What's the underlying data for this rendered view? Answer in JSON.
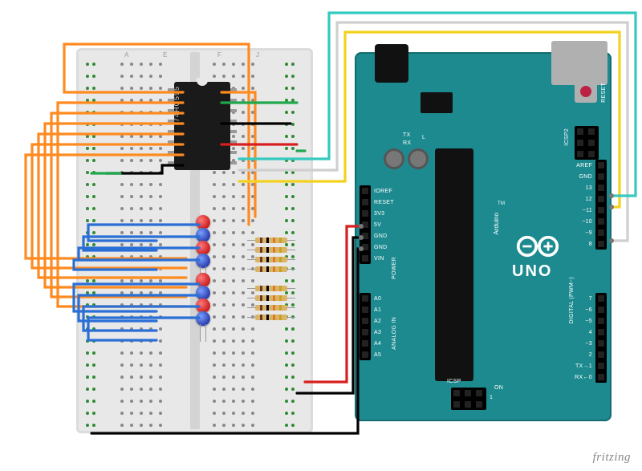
{
  "software_watermark": "fritzing",
  "ic": {
    "label": "74HC595",
    "pins": 16
  },
  "leds": [
    {
      "id": 1,
      "color": "red"
    },
    {
      "id": 2,
      "color": "blue"
    },
    {
      "id": 3,
      "color": "red"
    },
    {
      "id": 4,
      "color": "blue"
    },
    {
      "id": 5,
      "color": "red"
    },
    {
      "id": 6,
      "color": "blue"
    },
    {
      "id": 7,
      "color": "red"
    },
    {
      "id": 8,
      "color": "blue"
    }
  ],
  "resistors": {
    "count": 8,
    "bands": [
      "brown",
      "black",
      "orange",
      "gold"
    ]
  },
  "arduino": {
    "model": "UNO",
    "brand": "Arduino",
    "trademark": "TM",
    "reset_label": "RESET",
    "tx_label": "TX",
    "rx_label": "RX",
    "l_label": "L",
    "on_label": "ON",
    "icsp_label": "ICSP",
    "icsp2_label": "ICSP2",
    "power_group": "POWER",
    "analog_group": "ANALOG IN",
    "digital_group": "DIGITAL (PWM~)",
    "headers": {
      "power": [
        "IOREF",
        "RESET",
        "3V3",
        "5V",
        "GND",
        "GND",
        "VIN"
      ],
      "analog": [
        "A0",
        "A1",
        "A2",
        "A3",
        "A4",
        "A5"
      ],
      "digital_high": [
        "AREF",
        "GND",
        "13",
        "12",
        "~11",
        "~10",
        "~9",
        "8"
      ],
      "digital_low": [
        "7",
        "~6",
        "~5",
        "4",
        "~3",
        "2",
        "TX→1",
        "RX←0"
      ]
    }
  },
  "connections": {
    "shift_register_control": [
      {
        "wire": "yellow",
        "from": "74HC595 pin 14 (DS / DATA)",
        "to": "Arduino D11"
      },
      {
        "wire": "white",
        "from": "74HC595 pin 12 (ST_CP / LATCH)",
        "to": "Arduino D8"
      },
      {
        "wire": "cyan",
        "from": "74HC595 pin 11 (SH_CP / CLOCK)",
        "to": "Arduino D12"
      }
    ],
    "shift_register_power": [
      {
        "wire": "green",
        "from": "74HC595 pin 16 (VCC)",
        "to": "breadboard + rail"
      },
      {
        "wire": "red",
        "from": "74HC595 pin 10 (MR)",
        "to": "breadboard + rail"
      },
      {
        "wire": "black",
        "from": "74HC595 pin 8 (GND)",
        "to": "breadboard − rail"
      },
      {
        "wire": "black",
        "from": "74HC595 pin 13 (OE)",
        "to": "breadboard − rail"
      }
    ],
    "outputs": "Q0–Q7 → orange wires → LED anodes; LED cathodes → blue wires → resistors → − rail",
    "rails": [
      {
        "wire": "red",
        "from": "breadboard + rail",
        "to": "Arduino 5V"
      },
      {
        "wire": "black",
        "from": "breadboard − rail (right)",
        "to": "Arduino GND"
      },
      {
        "wire": "black",
        "from": "breadboard − rail (left)",
        "to": "Arduino GND"
      }
    ]
  }
}
